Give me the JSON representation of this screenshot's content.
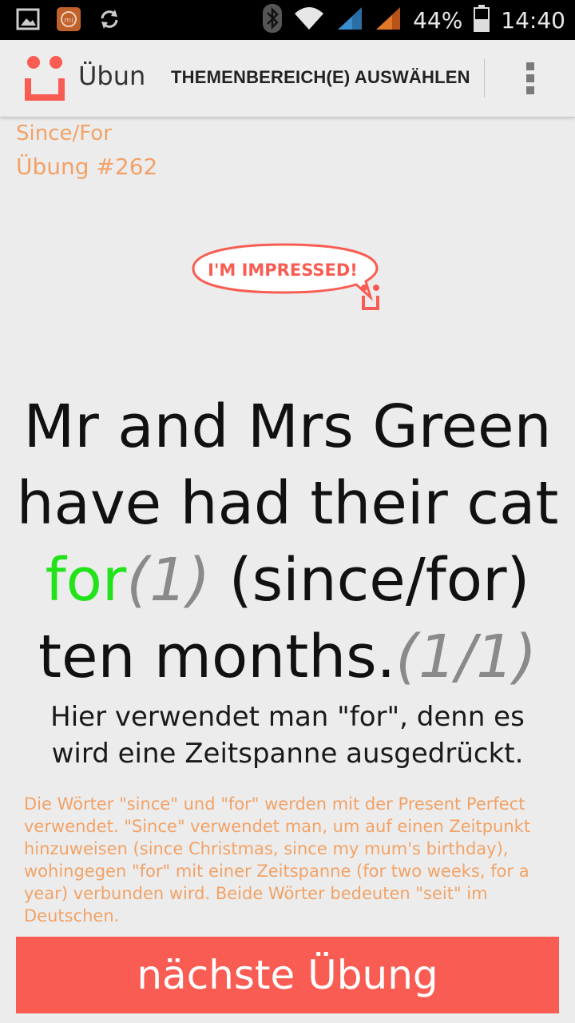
{
  "status_bar": {
    "battery_percent": "44%",
    "time": "14:40",
    "icons": [
      "image-notification-icon",
      "mi-app-icon",
      "sync-icon",
      "bluetooth-icon",
      "wifi-icon",
      "signal-icon",
      "signal-icon-2",
      "battery-icon"
    ]
  },
  "appbar": {
    "title": "Übun",
    "topic_button_label": "THEMENBEREICH(E) AUSWÄHLEN",
    "overflow_icon": "overflow-menu-icon"
  },
  "exercise": {
    "topic": "Since/For",
    "number": "Übung #262"
  },
  "badge": {
    "text": "I'M IMPRESSED!"
  },
  "sentence": {
    "part1": "Mr and Mrs Green have had their cat",
    "answer": "for",
    "answer_count": "(1)",
    "hint": "(since/for)",
    "part2": "ten months.",
    "score": "(1/1)"
  },
  "explanation": "Hier verwendet man \"for\", denn es wird eine Zeitspanne ausgedrückt.",
  "rule_text": "Die Wörter \"since\" und \"for\" werden mit der Present Perfect verwendet. \"Since\" verwendet man, um auf einen Zeitpunkt hinzuweisen (since Christmas, since my mum's birthday), wohingegen \"for\" mit einer Zeitspanne (for two weeks, for a year) verbunden wird. Beide Wörter bedeuten \"seit\" im Deutschen.",
  "next_button_label": "nächste Übung",
  "colors": {
    "accent": "#f95c52",
    "orange_text": "#f2a266",
    "correct_green": "#22e31a"
  }
}
